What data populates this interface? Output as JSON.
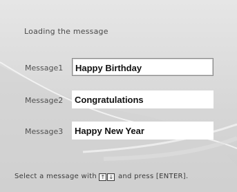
{
  "heading": "Loading the message",
  "messages": [
    {
      "label": "Message1",
      "value": "Happy Birthday",
      "selected": true
    },
    {
      "label": "Message2",
      "value": "Congratulations",
      "selected": false
    },
    {
      "label": "Message3",
      "value": "Happy New Year",
      "selected": false
    }
  ],
  "footer": {
    "prefix": "Select a message with",
    "up_key": "↑",
    "down_key": "↓",
    "suffix": "and press [ENTER]."
  }
}
